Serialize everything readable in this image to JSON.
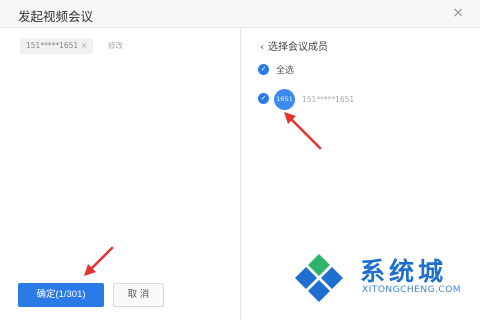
{
  "dialog": {
    "title": "发起视频会议",
    "close_glyph": "×"
  },
  "left": {
    "tag_text": "151*****1651",
    "tag_remove": "×",
    "modify_text": "修改"
  },
  "right": {
    "back_glyph": "‹",
    "back_label": "选择会议成员",
    "select_all": "全选",
    "check_glyph": "✓",
    "member": {
      "avatar_text": "1651",
      "name": "151*****1651"
    }
  },
  "footer": {
    "confirm_label": "确定(1/301)",
    "cancel_label": "取 消"
  },
  "watermark": {
    "name": "系统城",
    "url": "XITONGCHENG.COM"
  },
  "colors": {
    "accent": "#2a7be6",
    "arrow": "#e8322d",
    "watermark_blue": "#1f6fd0",
    "watermark_green": "#2fb36a"
  }
}
